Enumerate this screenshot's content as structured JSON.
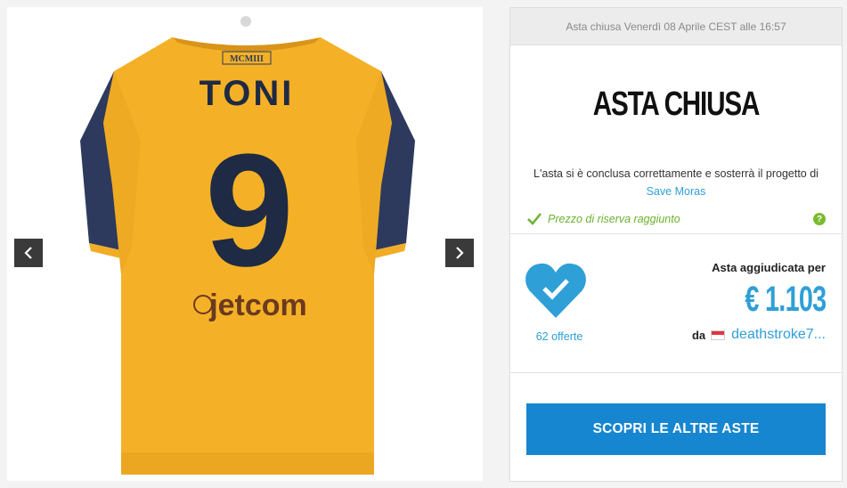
{
  "colors": {
    "accent": "#2f9fd7",
    "button": "#1786d0",
    "reserve": "#6cb12f",
    "shirt": "#f4b127",
    "shirt_sleeve": "#2d3a5e"
  },
  "gallery": {
    "prev_icon": "chevron-left-icon",
    "next_icon": "chevron-right-icon",
    "shirt_print": {
      "crest_text": "MCMIII",
      "name": "TONI",
      "number": "9",
      "sponsor": "jetcom"
    }
  },
  "auction": {
    "header": "Asta chiusa Venerdì 08 Aprile CEST alle 16:57",
    "closed_title": "ASTA CHIUSA",
    "closed_text": "L'asta si è conclusa correttamente e sosterrà il progetto di",
    "project_link": "Save Moras",
    "reserve_text": "Prezzo di riserva raggiunto",
    "help_symbol": "?",
    "offers_count": "62 offerte",
    "won_label": "Asta aggiudicata per",
    "won_price": "€ 1.103",
    "winner_prefix": "da",
    "winner_name": "deathstroke7...",
    "cta_label": "SCOPRI LE ALTRE ASTE"
  }
}
